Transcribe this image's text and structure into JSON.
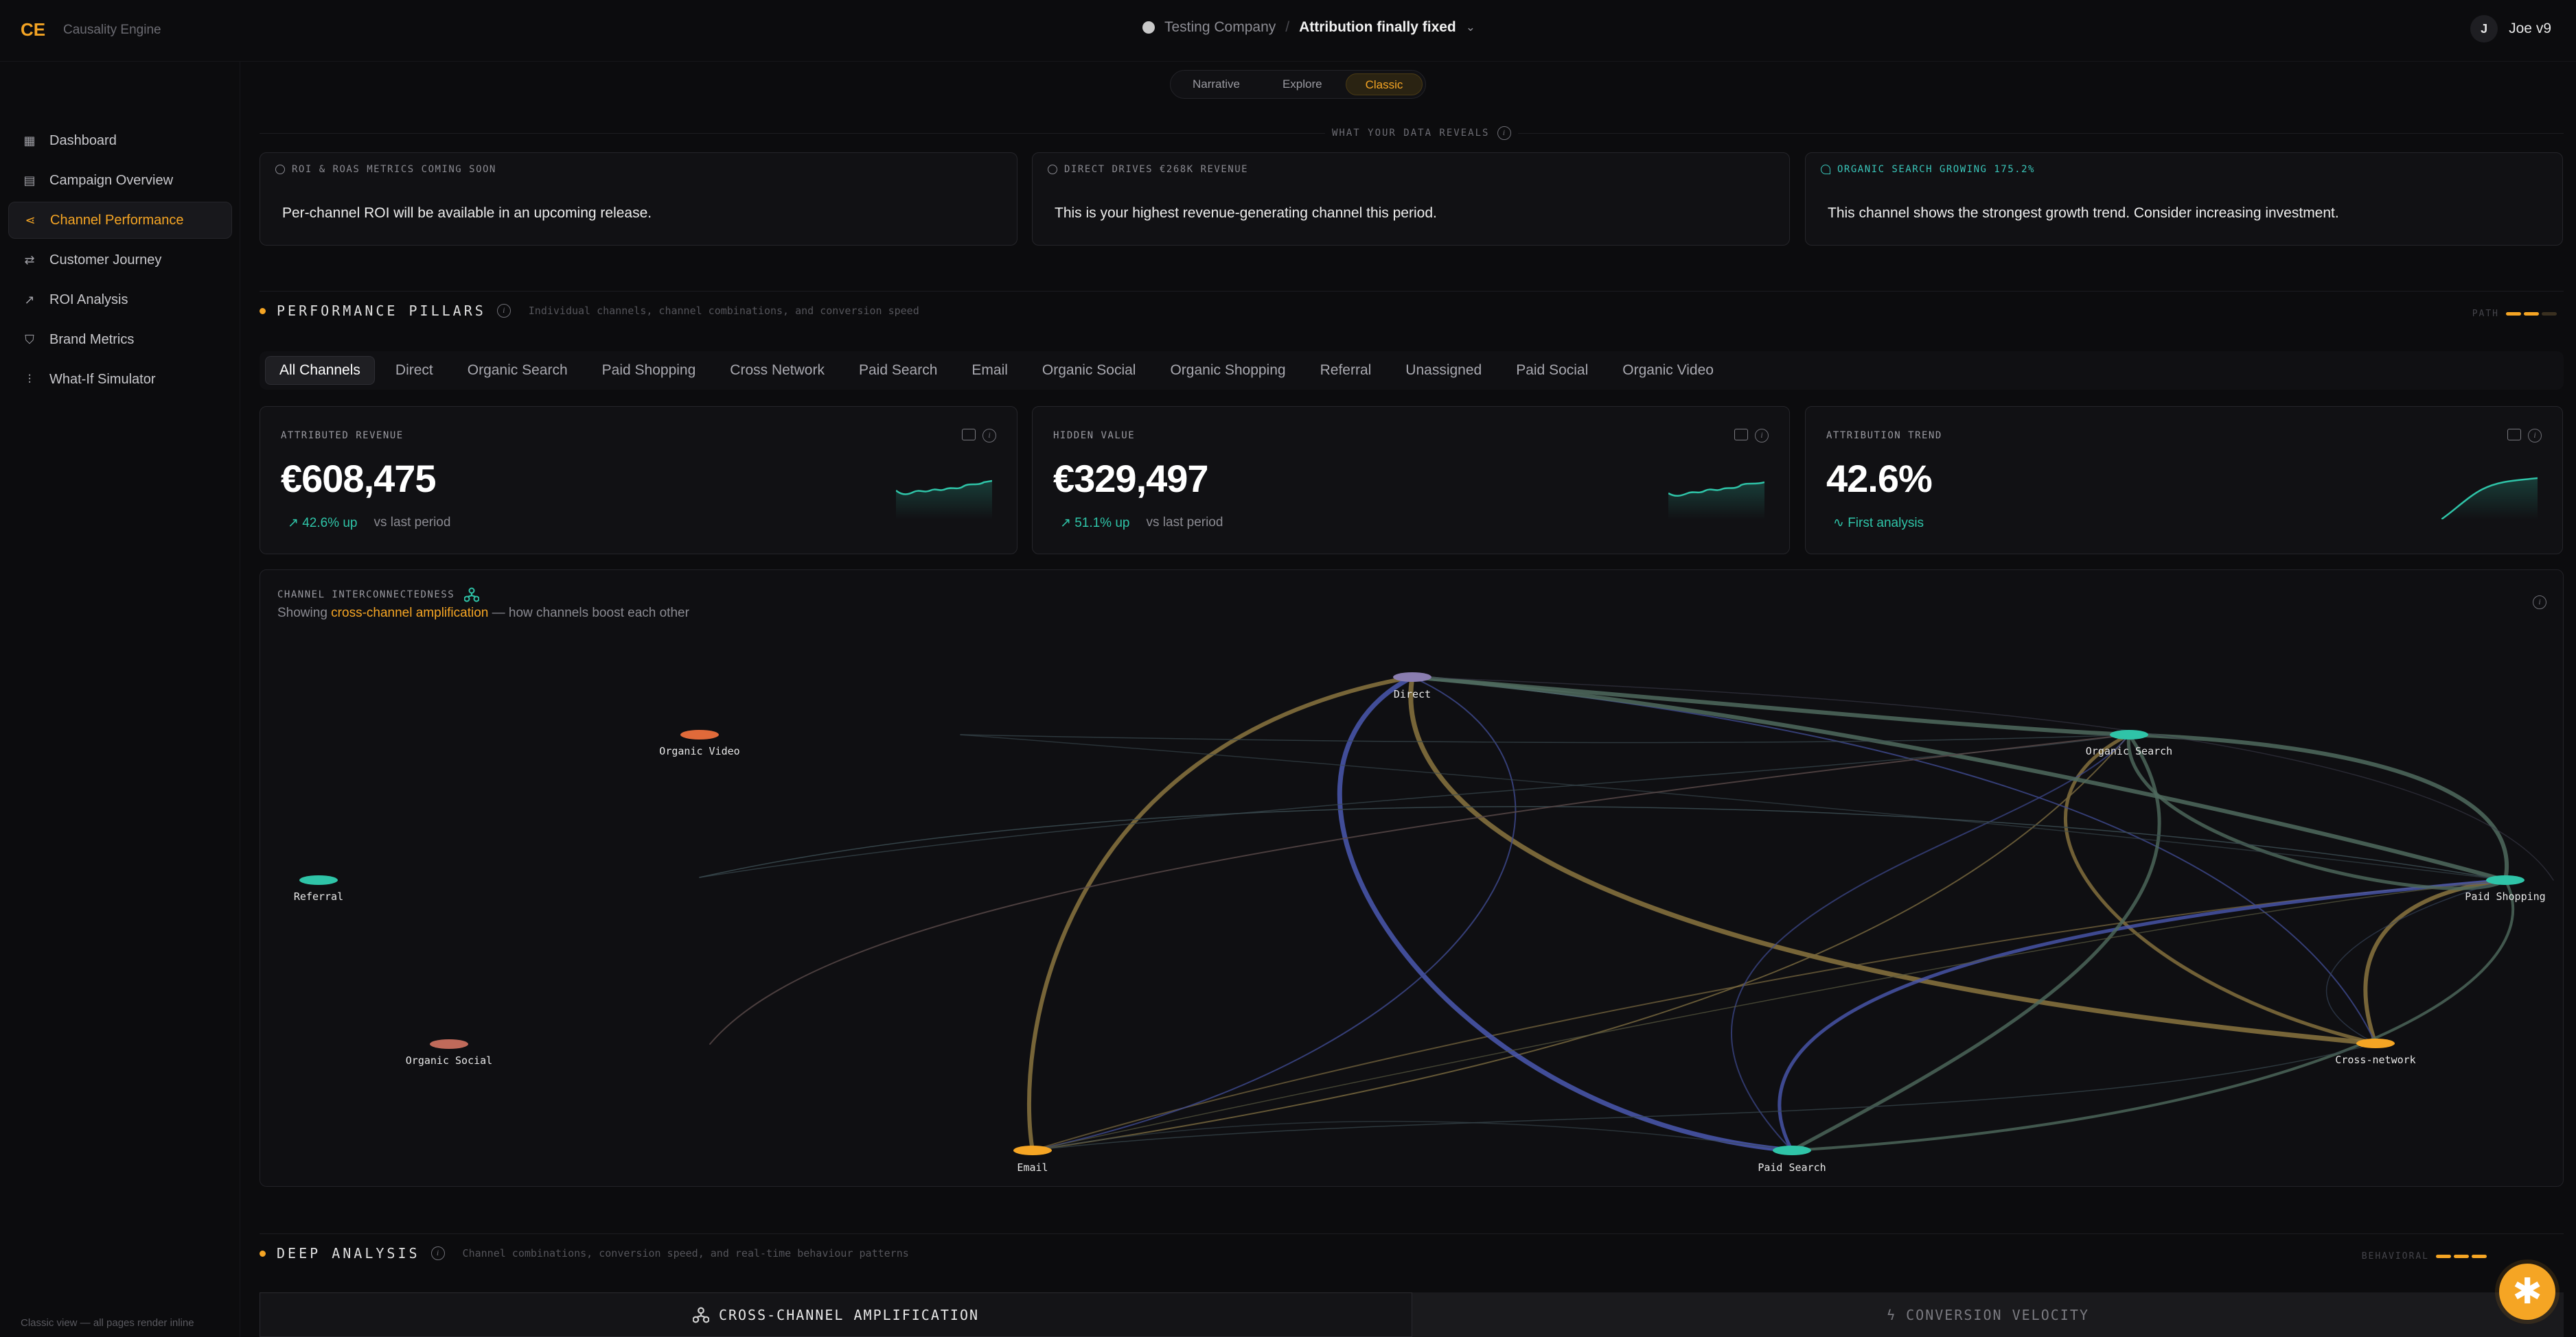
{
  "app": {
    "logo": "CE",
    "name": "Causality Engine"
  },
  "breadcrumb": {
    "company": "Testing Company",
    "separator": "/",
    "project": "Attribution finally fixed"
  },
  "user": {
    "initial": "J",
    "name": "Joe v9"
  },
  "views": [
    "Narrative",
    "Explore",
    "Classic"
  ],
  "sidebar": {
    "items": [
      {
        "label": "Dashboard",
        "icon": "dashboard-icon"
      },
      {
        "label": "Campaign Overview",
        "icon": "campaign-icon"
      },
      {
        "label": "Channel Performance",
        "icon": "share-icon"
      },
      {
        "label": "Customer Journey",
        "icon": "journey-icon"
      },
      {
        "label": "ROI Analysis",
        "icon": "trend-icon"
      },
      {
        "label": "Brand Metrics",
        "icon": "shield-icon"
      },
      {
        "label": "What-If Simulator",
        "icon": "sliders-icon"
      }
    ],
    "active": "Channel Performance",
    "footer": "Classic view — all pages render inline"
  },
  "reveals": {
    "title": "WHAT YOUR DATA REVEALS"
  },
  "insights": [
    {
      "title": "ROI & ROAS METRICS COMING SOON",
      "body": "Per-channel ROI will be available in an upcoming release."
    },
    {
      "title": "DIRECT DRIVES €268K REVENUE",
      "body": "This is your highest revenue-generating channel this period."
    },
    {
      "title": "ORGANIC SEARCH GROWING 175.2%",
      "body": "This channel shows the strongest growth trend. Consider increasing investment."
    }
  ],
  "pillars": {
    "title": "PERFORMANCE PILLARS",
    "subtitle": "Individual channels, channel combinations, and conversion speed",
    "tag": "PATH"
  },
  "channels": [
    "All Channels",
    "Direct",
    "Organic Search",
    "Paid Shopping",
    "Cross Network",
    "Paid Search",
    "Email",
    "Organic Social",
    "Organic Shopping",
    "Referral",
    "Unassigned",
    "Paid Social",
    "Organic Video"
  ],
  "kpis": [
    {
      "label": "ATTRIBUTED REVENUE",
      "value": "€608,475",
      "delta": "42.6% up",
      "vs": "vs last period"
    },
    {
      "label": "HIDDEN VALUE",
      "value": "€329,497",
      "delta": "51.1% up",
      "vs": "vs last period"
    },
    {
      "label": "ATTRIBUTION TREND",
      "value": "42.6%",
      "delta": "First analysis",
      "vs": ""
    }
  ],
  "network": {
    "title": "CHANNEL INTERCONNECTEDNESS",
    "sub_pre": "Showing ",
    "sub_em": "cross-channel amplification",
    "sub_post": " — how channels boost each other",
    "nodes": [
      "Direct",
      "Organic Video",
      "Organic Search",
      "Referral",
      "Paid Shopping",
      "Organic Social",
      "Cross-network",
      "Email",
      "Paid Search"
    ]
  },
  "deep": {
    "title": "DEEP ANALYSIS",
    "subtitle": "Channel combinations, conversion speed, and real-time behaviour patterns",
    "tag": "BEHAVIORAL"
  },
  "bottom_tabs": [
    "CROSS-CHANNEL AMPLIFICATION",
    "CONVERSION VELOCITY"
  ],
  "colors": {
    "accent": "#f5a524",
    "teal": "#2fc4a8",
    "indigo": "#4c5bb0"
  }
}
